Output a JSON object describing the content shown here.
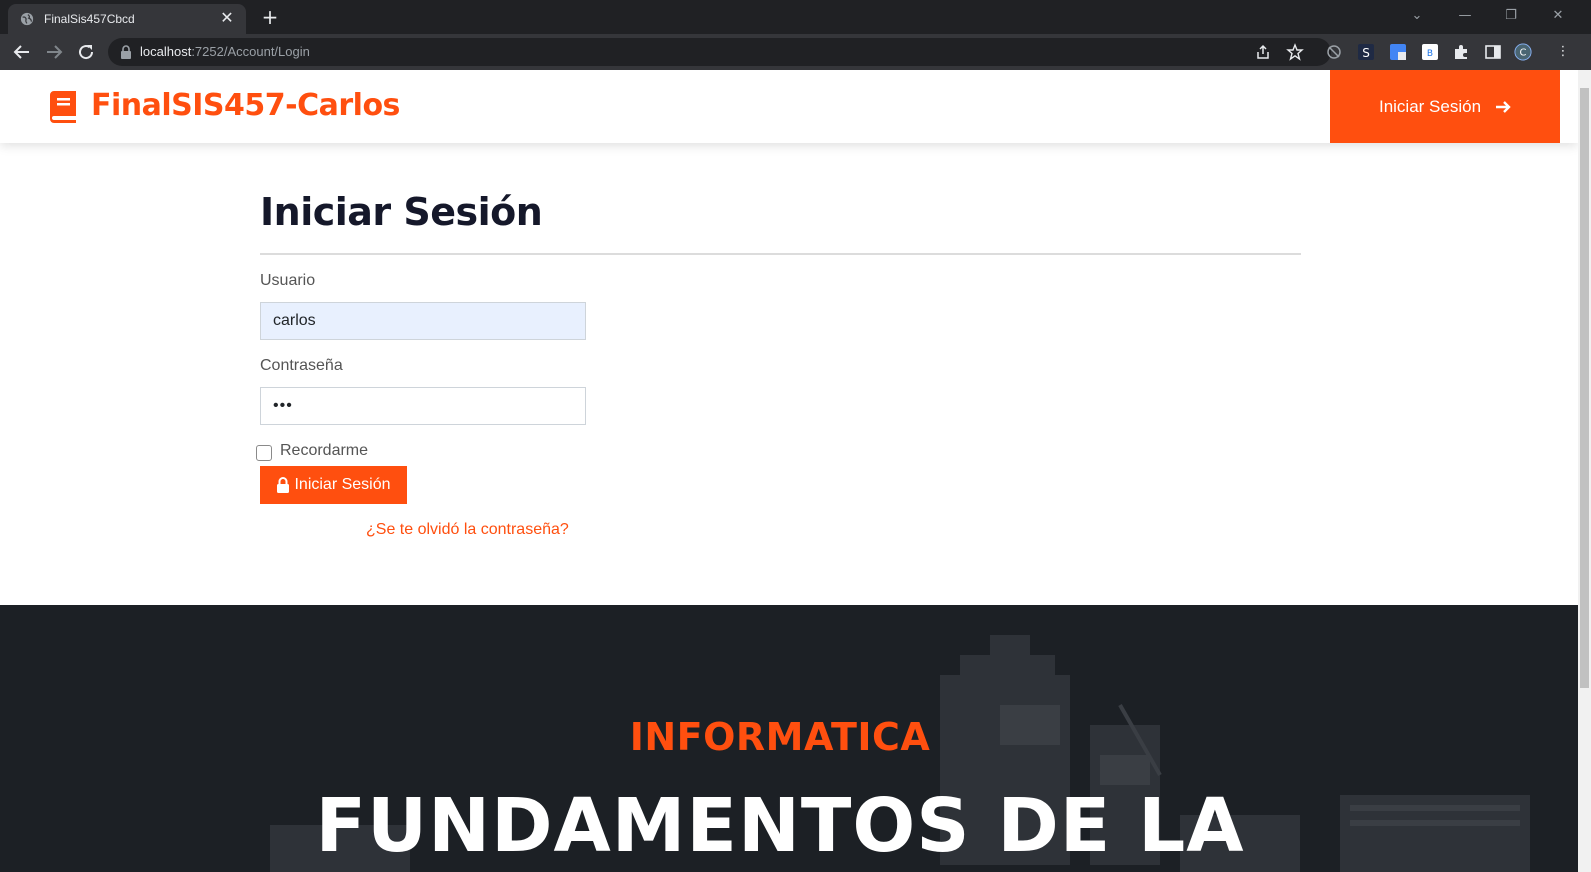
{
  "browser": {
    "tab_title": "FinalSis457Cbcd",
    "url_host": "localhost",
    "url_rest": ":7252/Account/Login"
  },
  "navbar": {
    "brand": "FinalSIS457-Carlos",
    "login_label": "Iniciar Sesión"
  },
  "form": {
    "title": "Iniciar Sesión",
    "username_label": "Usuario",
    "username_value": "carlos",
    "password_label": "Contraseña",
    "password_value": "•••",
    "remember_label": "Recordarme",
    "remember_checked": false,
    "submit_label": "Iniciar Sesión",
    "forgot_link": "¿Se te olvidó la contraseña?"
  },
  "hero": {
    "subtitle": "INFORMATICA",
    "title": "FUNDAMENTOS DE LA"
  },
  "colors": {
    "accent": "#ff4f0f",
    "dark": "#1c2025"
  }
}
